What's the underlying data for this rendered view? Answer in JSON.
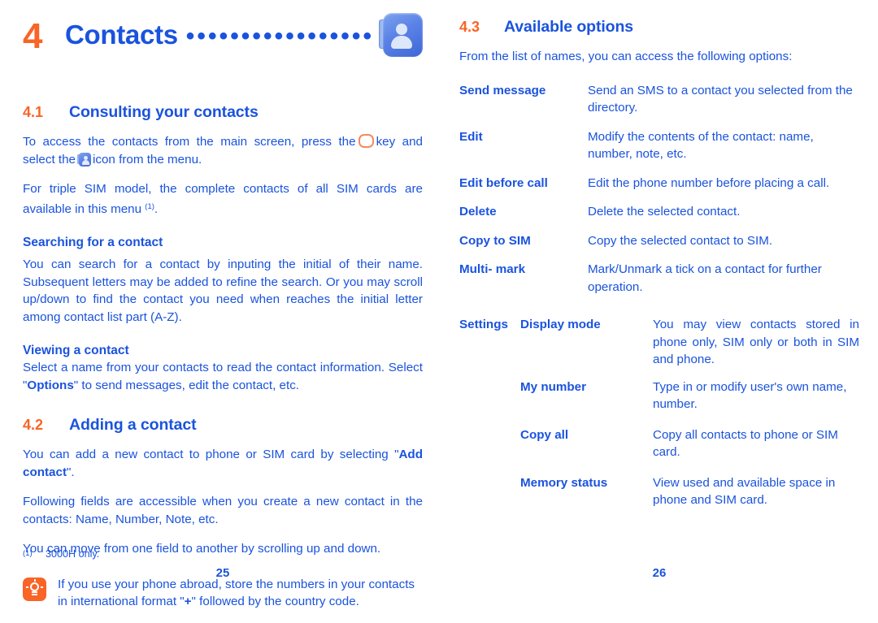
{
  "chapter": {
    "number": "4",
    "title": "Contacts",
    "leader_dots": "•••••••••••••••••••••••••",
    "icon": "contacts-book-icon"
  },
  "left_column": {
    "sections": [
      {
        "number": "4.1",
        "title": "Consulting your contacts"
      },
      {
        "number": "4.2",
        "title": "Adding a contact"
      }
    ],
    "para_access_1": "To access the contacts from the main screen, press the",
    "para_access_2": "key and select the",
    "para_access_3": "icon from the menu.",
    "para_triple_sim_a": "For triple SIM model, the complete contacts of all SIM cards are available in this menu",
    "para_triple_sim_footnote": "(1)",
    "para_triple_sim_b": ".",
    "sub_heading_search": "Searching for a contact",
    "para_search": "You can search for a contact by inputing the initial of their name. Subsequent letters may be added to refine the search. Or you may scroll up/down to find the contact you need when reaches the initial letter among contact list part (A-Z).",
    "sub_heading_viewing": "Viewing a contact",
    "para_viewing_1": "Select a name from your contacts to read the contact information. Select \"",
    "para_viewing_bold": "Options",
    "para_viewing_2": "\" to send messages, edit the contact, etc.",
    "para_add_1": "You can add a new contact to phone or SIM card by selecting \"",
    "para_add_bold": "Add contact",
    "para_add_2": "\".",
    "para_fields": "Following fields are accessible when you create a new contact in the contacts: Name, Number, Note, etc.",
    "para_move": "You can move from one field to another by scrolling up and down.",
    "tip": {
      "icon": "lightbulb-tip-icon",
      "text_1": "If you use your phone abroad, store the numbers in your contacts in international format \"",
      "text_bold": "+",
      "text_2": "\" followed by the country code."
    },
    "footnote_mark": "(1)",
    "footnote_text": "3000H only.",
    "page_number": "25"
  },
  "right_column": {
    "section": {
      "number": "4.3",
      "title": "Available options"
    },
    "intro": "From the list of names, you can access the following options:",
    "options": [
      {
        "term": "Send message",
        "description": "Send an SMS to a contact you selected from the directory."
      },
      {
        "term": "Edit",
        "description": "Modify the contents of the contact: name, number, note, etc."
      },
      {
        "term": "Edit before call",
        "description": "Edit the phone number before placing a call."
      },
      {
        "term": "Delete",
        "description": "Delete the selected contact."
      },
      {
        "term": "Copy to SIM",
        "description": "Copy the selected contact to SIM."
      },
      {
        "term": "Multi- mark",
        "description": "Mark/Unmark a tick on a contact for further operation."
      }
    ],
    "settings": {
      "label": "Settings",
      "items": [
        {
          "term": "Display mode",
          "description": "You may view contacts stored in phone only, SIM only or both in SIM and phone."
        },
        {
          "term": "My number",
          "description": "Type in or modify user's own name, number."
        },
        {
          "term": "Copy all",
          "description": "Copy all contacts to phone or SIM card."
        },
        {
          "term": "Memory status",
          "description": "View used and available space in phone and SIM card."
        }
      ]
    },
    "page_number": "26"
  },
  "colors": {
    "accent_orange": "#f96427",
    "text_blue": "#1a53dd"
  }
}
